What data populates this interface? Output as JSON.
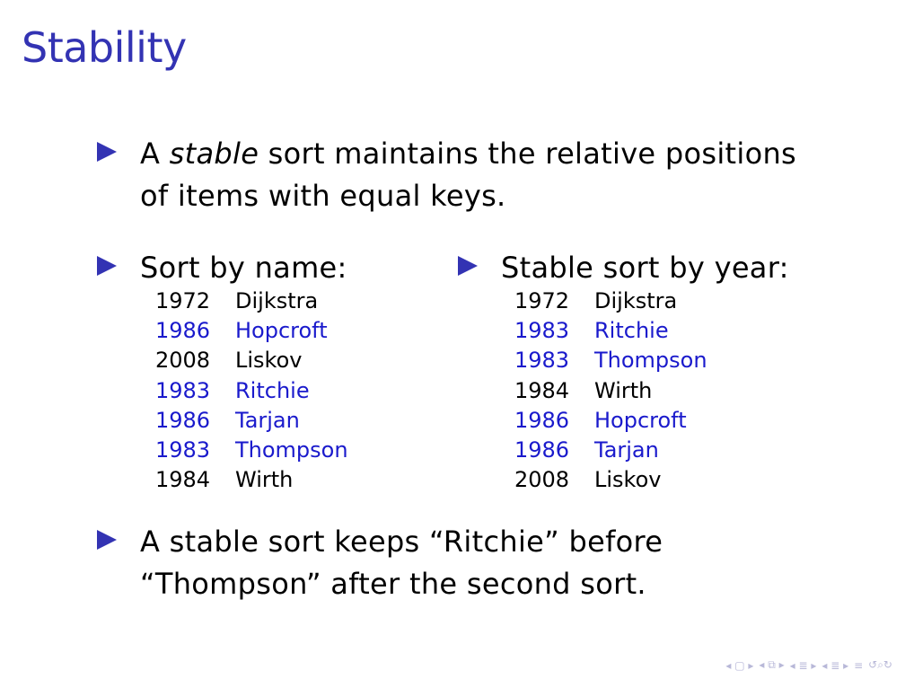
{
  "title": "Stability",
  "bullet1": {
    "pre": "A ",
    "emph": "stable",
    "post": " sort maintains the relative positions of items with equal keys."
  },
  "left_column": {
    "heading": "Sort by name:",
    "rows": [
      {
        "year": "1972",
        "name": "Dijkstra",
        "color": "black"
      },
      {
        "year": "1986",
        "name": "Hopcroft",
        "color": "blue"
      },
      {
        "year": "2008",
        "name": "Liskov",
        "color": "black"
      },
      {
        "year": "1983",
        "name": "Ritchie",
        "color": "blue"
      },
      {
        "year": "1986",
        "name": "Tarjan",
        "color": "blue"
      },
      {
        "year": "1983",
        "name": "Thompson",
        "color": "blue"
      },
      {
        "year": "1984",
        "name": "Wirth",
        "color": "black"
      }
    ]
  },
  "right_column": {
    "heading": "Stable sort by year:",
    "rows": [
      {
        "year": "1972",
        "name": "Dijkstra",
        "color": "black"
      },
      {
        "year": "1983",
        "name": "Ritchie",
        "color": "blue"
      },
      {
        "year": "1983",
        "name": "Thompson",
        "color": "blue"
      },
      {
        "year": "1984",
        "name": "Wirth",
        "color": "black"
      },
      {
        "year": "1986",
        "name": "Hopcroft",
        "color": "blue"
      },
      {
        "year": "1986",
        "name": "Tarjan",
        "color": "blue"
      },
      {
        "year": "2008",
        "name": "Liskov",
        "color": "black"
      }
    ]
  },
  "bullet3": "A stable sort keeps “Ritchie” before “Thompson” after the second sort.",
  "colors": {
    "title": "#3333b3",
    "bullet": "#3333b3",
    "highlight": "#1a1acc",
    "nav": "#b8b8d8"
  },
  "navigation": {
    "icons": [
      "nav-first-icon",
      "nav-prev-frame-icon",
      "nav-prev-subsection-icon",
      "nav-prev-section-icon",
      "nav-align-icon",
      "nav-search-icon"
    ]
  }
}
